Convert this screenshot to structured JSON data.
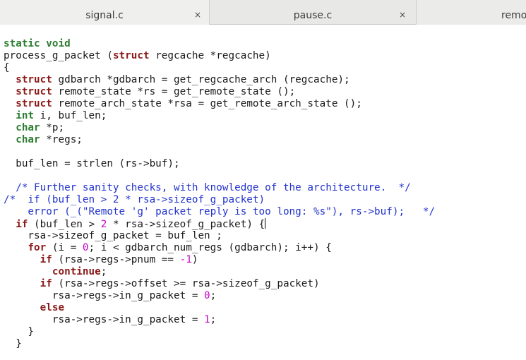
{
  "tabs": [
    {
      "label": "signal.c",
      "close": "×"
    },
    {
      "label": "pause.c",
      "close": "×"
    },
    {
      "label": "remo"
    }
  ],
  "code_lines": [
    [
      {
        "t": "static void",
        "c": "ty"
      }
    ],
    [
      {
        "t": "process_g_packet ("
      },
      {
        "t": "struct",
        "c": "kw"
      },
      {
        "t": " regcache *regcache)"
      }
    ],
    [
      {
        "t": "{"
      }
    ],
    [
      {
        "t": "  "
      },
      {
        "t": "struct",
        "c": "kw"
      },
      {
        "t": " gdbarch *gdbarch = get_regcache_arch (regcache);"
      }
    ],
    [
      {
        "t": "  "
      },
      {
        "t": "struct",
        "c": "kw"
      },
      {
        "t": " remote_state *rs = get_remote_state ();"
      }
    ],
    [
      {
        "t": "  "
      },
      {
        "t": "struct",
        "c": "kw"
      },
      {
        "t": " remote_arch_state *rsa = get_remote_arch_state ();"
      }
    ],
    [
      {
        "t": "  "
      },
      {
        "t": "int",
        "c": "ty"
      },
      {
        "t": " i, buf_len;"
      }
    ],
    [
      {
        "t": "  "
      },
      {
        "t": "char",
        "c": "ty"
      },
      {
        "t": " *p;"
      }
    ],
    [
      {
        "t": "  "
      },
      {
        "t": "char",
        "c": "ty"
      },
      {
        "t": " *regs;"
      }
    ],
    [
      {
        "t": ""
      }
    ],
    [
      {
        "t": "  buf_len = strlen (rs->buf);"
      }
    ],
    [
      {
        "t": ""
      }
    ],
    [
      {
        "t": "  /* Further sanity checks, with knowledge of the architecture.  */",
        "c": "cm"
      }
    ],
    [
      {
        "t": "/*  if (buf_len > 2 * rsa->sizeof_g_packet)",
        "c": "cm"
      }
    ],
    [
      {
        "t": "    error (_(\"Remote 'g' packet reply is too long: %s\"), rs->buf);   */",
        "c": "cm"
      }
    ],
    [
      {
        "t": "  "
      },
      {
        "t": "if",
        "c": "kw"
      },
      {
        "t": " (buf_len > "
      },
      {
        "t": "2",
        "c": "num"
      },
      {
        "t": " * rsa->sizeof_g_packet) {"
      },
      {
        "caret": true
      }
    ],
    [
      {
        "t": "    rsa->sizeof_g_packet = buf_len ;"
      }
    ],
    [
      {
        "t": "    "
      },
      {
        "t": "for",
        "c": "kw"
      },
      {
        "t": " (i = "
      },
      {
        "t": "0",
        "c": "num"
      },
      {
        "t": "; i < gdbarch_num_regs (gdbarch); i++) {"
      }
    ],
    [
      {
        "t": "      "
      },
      {
        "t": "if",
        "c": "kw"
      },
      {
        "t": " (rsa->regs->pnum == "
      },
      {
        "t": "-1",
        "c": "num"
      },
      {
        "t": ")"
      }
    ],
    [
      {
        "t": "        "
      },
      {
        "t": "continue",
        "c": "kw"
      },
      {
        "t": ";"
      }
    ],
    [
      {
        "t": "      "
      },
      {
        "t": "if",
        "c": "kw"
      },
      {
        "t": " (rsa->regs->offset >= rsa->sizeof_g_packet)"
      }
    ],
    [
      {
        "t": "        rsa->regs->in_g_packet = "
      },
      {
        "t": "0",
        "c": "num"
      },
      {
        "t": ";"
      }
    ],
    [
      {
        "t": "      "
      },
      {
        "t": "else",
        "c": "kw"
      }
    ],
    [
      {
        "t": "        rsa->regs->in_g_packet = "
      },
      {
        "t": "1",
        "c": "num"
      },
      {
        "t": ";"
      }
    ],
    [
      {
        "t": "    }"
      }
    ],
    [
      {
        "t": "  }"
      }
    ]
  ]
}
